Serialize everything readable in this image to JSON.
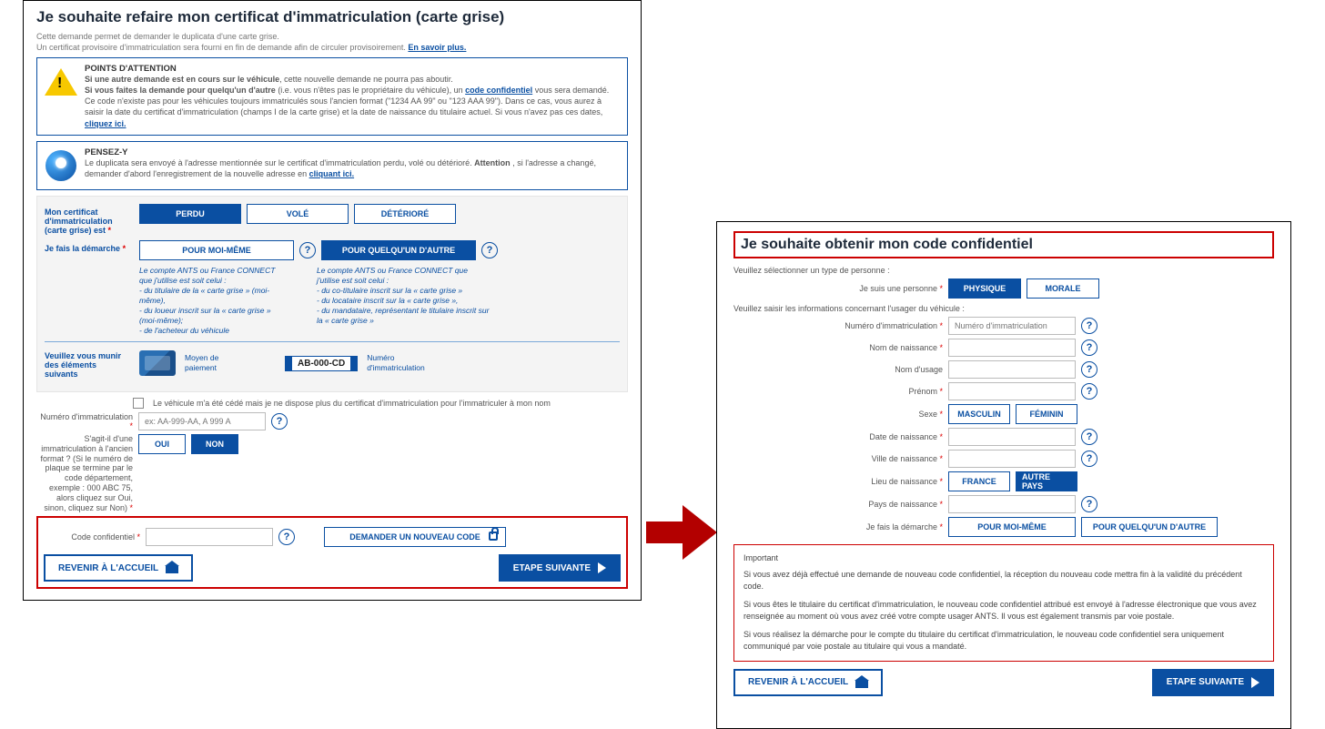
{
  "left": {
    "title": "Je souhaite refaire mon certificat d'immatriculation (carte grise)",
    "sub1": "Cette demande permet de demander le duplicata d'une carte grise.",
    "sub2": "Un certificat provisoire d'immatriculation sera fourni en fin de demande afin de circuler provisoirement. ",
    "learn_more": "En savoir plus.",
    "attention": {
      "title": "POINTS D'ATTENTION",
      "l1a": "Si une autre demande est en cours sur le véhicule",
      "l1b": ", cette nouvelle demande ne pourra pas aboutir.",
      "l2a": "Si vous faites la demande pour quelqu'un d'autre",
      "l2b": " (i.e. vous n'êtes pas le propriétaire du véhicule), un ",
      "l2link": "code confidentiel",
      "l2c": " vous sera demandé.",
      "l3": "Ce code n'existe pas pour les véhicules toujours immatriculés sous l'ancien format (\"1234 AA 99\" ou \"123 AAA 99\"). Dans ce cas, vous aurez à saisir la date du certificat d'immatriculation (champs I de la carte grise) et la date de naissance du titulaire actuel. Si vous n'avez pas ces dates, ",
      "l3link": "cliquez ici."
    },
    "pensez": {
      "title": "PENSEZ-Y",
      "txt": "Le duplicata sera envoyé à l'adresse mentionnée sur le certificat d'immatriculation perdu, volé ou détérioré. ",
      "bold": "Attention",
      "txt2": ", si l'adresse a changé, demander d'abord l'enregistrement de la nouvelle adresse en ",
      "link": "cliquant ici."
    },
    "status_label": "Mon certificat d'immatriculation (carte grise) est",
    "status_opts": {
      "perdu": "PERDU",
      "vole": "VOLÉ",
      "deteriore": "DÉTÉRIORÉ"
    },
    "demarche_label": "Je fais la démarche",
    "pour_moi": "POUR MOI-MÊME",
    "pour_autre": "POUR QUELQU'UN D'AUTRE",
    "note_moi_h": "Le compte ANTS ou France CONNECT que j'utilise est soit celui :",
    "note_moi_li1": "- du titulaire de la « carte grise » (moi-même),",
    "note_moi_li2": "- du loueur inscrit sur la « carte grise » (moi-même);",
    "note_moi_li3": "- de l'acheteur du véhicule",
    "note_autre_h": "Le compte ANTS ou France CONNECT que j'utilise est soit celui :",
    "note_autre_li1": "- du co-titulaire inscrit sur la « carte grise »",
    "note_autre_li2": "- du locataire inscrit sur la « carte grise »,",
    "note_autre_li3": "- du mandataire, représentant le titulaire inscrit sur la « carte grise »",
    "elements_label": "Veuillez vous munir des éléments suivants",
    "moyen_paie": "Moyen de paiement",
    "plate": "AB-000-CD",
    "num_immat": "Numéro d'immatriculation",
    "chk_txt": "Le véhicule m'a été cédé mais je ne dispose plus du certificat d'immatriculation pour l'immatriculer à mon nom",
    "num_immat_lbl": "Numéro d'immatriculation",
    "num_immat_ph": "ex: AA-999-AA, A 999 A",
    "ancien_lbl": "S'agit-il d'une immatriculation à l'ancien format ? (Si le numéro de plaque se termine par le code département, exemple : 000 ABC 75, alors cliquez sur Oui, sinon, cliquez sur Non)",
    "oui": "OUI",
    "non": "NON",
    "code_lbl": "Code confidentiel",
    "demander_code": "DEMANDER UN NOUVEAU CODE",
    "revenir": "REVENIR À L'ACCUEIL",
    "suivante": "ETAPE SUIVANTE"
  },
  "right": {
    "title": "Je souhaite obtenir mon code confidentiel",
    "select_type": "Veuillez sélectionner un type de personne :",
    "personne_lbl": "Je suis une personne",
    "physique": "PHYSIQUE",
    "morale": "MORALE",
    "info_usager": "Veuillez saisir les informations concernant l'usager du véhicule :",
    "num_immat": "Numéro d'immatriculation",
    "num_immat_ph": "Numéro d'immatriculation",
    "nom_naiss": "Nom de naissance",
    "nom_usage": "Nom d'usage",
    "prenom": "Prénom",
    "sexe": "Sexe",
    "masc": "MASCULIN",
    "fem": "FÉMININ",
    "date_naiss": "Date de naissance",
    "ville_naiss": "Ville de naissance",
    "lieu_naiss": "Lieu de naissance",
    "france": "FRANCE",
    "autre_pays": "AUTRE PAYS",
    "pays_naiss": "Pays de naissance",
    "demarche_lbl": "Je fais la démarche",
    "pour_moi": "POUR MOI-MÊME",
    "pour_autre": "POUR QUELQU'UN D'AUTRE",
    "imp_title": "Important",
    "imp1": "Si vous avez déjà effectué une demande de nouveau code confidentiel, la réception du nouveau code mettra fin à la validité du précédent code.",
    "imp2": "Si vous êtes le titulaire du certificat d'immatriculation, le nouveau code confidentiel attribué est envoyé à l'adresse électronique que vous avez renseignée au moment où vous avez créé votre compte usager ANTS. Il vous est également transmis par voie postale.",
    "imp3": "Si vous réalisez la démarche pour le compte du titulaire du certificat d'immatriculation, le nouveau code confidentiel sera uniquement communiqué par voie postale au titulaire qui vous a mandaté.",
    "revenir": "REVENIR À L'ACCUEIL",
    "suivante": "ETAPE SUIVANTE"
  }
}
